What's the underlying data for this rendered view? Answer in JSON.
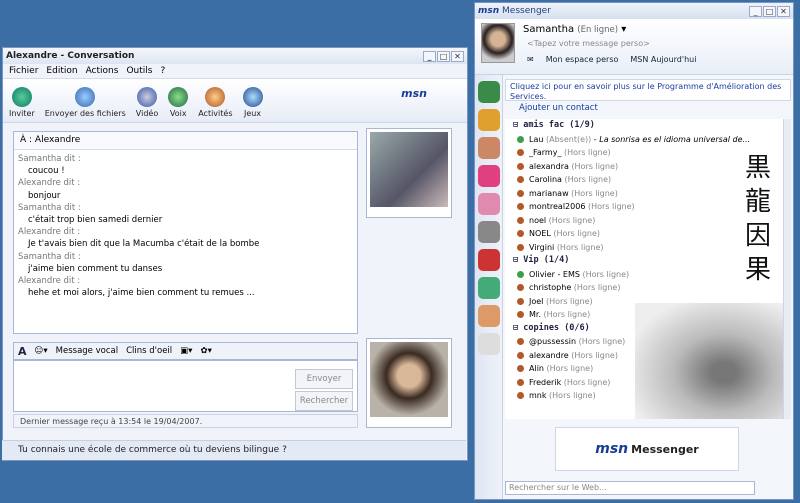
{
  "conversation": {
    "title": "Alexandre - Conversation",
    "menu": [
      "Fichier",
      "Edition",
      "Actions",
      "Outils",
      "?"
    ],
    "toolbar": [
      "Inviter",
      "Envoyer des fichiers",
      "Vidéo",
      "Voix",
      "Activités",
      "Jeux"
    ],
    "logo": "msn",
    "to_label": "À : Alexandre",
    "messages": [
      {
        "who": "Samantha dit :",
        "text": "coucou !"
      },
      {
        "who": "Alexandre dit :",
        "text": "bonjour"
      },
      {
        "who": "Samantha dit :",
        "text": "c'était trop bien samedi dernier"
      },
      {
        "who": "Alexandre dit :",
        "text": "Je t'avais bien dit que la Macumba c'était de la bombe"
      },
      {
        "who": "Samantha dit :",
        "text": "j'aime bien comment tu danses"
      },
      {
        "who": "Alexandre dit :",
        "text": "hehe et moi alors, j'aime bien comment tu remues ..."
      }
    ],
    "format_bar": [
      "A",
      "Message vocal",
      "Clins d'oeil"
    ],
    "send": "Envoyer",
    "search": "Rechercher",
    "status": "Dernier message reçu à 13:54 le 19/04/2007.",
    "footer": "Tu connais une école de commerce où tu deviens bilingue ?"
  },
  "messenger": {
    "title": "Messenger",
    "name": "Samantha",
    "state": "(En ligne)",
    "perso": "<Tapez votre message perso>",
    "links": [
      "Mon espace perso",
      "MSN Aujourd'hui"
    ],
    "notice": "Cliquez ici pour en savoir plus sur le Programme d'Amélioration des Services.",
    "add_contact": "Ajouter un contact",
    "groups": [
      {
        "name": "amis fac (1/9)",
        "contacts": [
          {
            "n": "Lau",
            "s": "(Absent(e))",
            "m": "La sonrisa es el idioma universal de...",
            "on": true
          },
          {
            "n": "_Farmy_",
            "s": "(Hors ligne)"
          },
          {
            "n": "alexandra",
            "s": "(Hors ligne)"
          },
          {
            "n": "Carolina",
            "s": "(Hors ligne)"
          },
          {
            "n": "marianaw",
            "s": "(Hors ligne)"
          },
          {
            "n": "montreal2006",
            "s": "(Hors ligne)"
          },
          {
            "n": "noel",
            "s": "(Hors ligne)"
          },
          {
            "n": "NOEL",
            "s": "(Hors ligne)"
          },
          {
            "n": "Virgini",
            "s": "(Hors ligne)"
          }
        ]
      },
      {
        "name": "Vip (1/4)",
        "contacts": [
          {
            "n": "Olivier - EMS",
            "s": "(Hors ligne)",
            "on": true
          },
          {
            "n": "christophe",
            "s": "(Hors ligne)"
          },
          {
            "n": "Joel",
            "s": "(Hors ligne)"
          },
          {
            "n": "Mr.",
            "s": "(Hors ligne)"
          }
        ]
      },
      {
        "name": "copines (0/6)",
        "contacts": [
          {
            "n": "@pussessin",
            "s": "(Hors ligne)"
          },
          {
            "n": "alexandre",
            "s": "(Hors ligne)"
          },
          {
            "n": "Alin",
            "s": "(Hors ligne)"
          },
          {
            "n": "Frederik",
            "s": "(Hors ligne)"
          },
          {
            "n": "mnk",
            "s": "(Hors ligne)"
          }
        ]
      }
    ],
    "kanji": [
      "黒",
      "龍",
      "因",
      "果"
    ],
    "banner_logo": "msn",
    "banner_text": "Messenger",
    "search_placeholder": "Rechercher sur le Web..."
  }
}
